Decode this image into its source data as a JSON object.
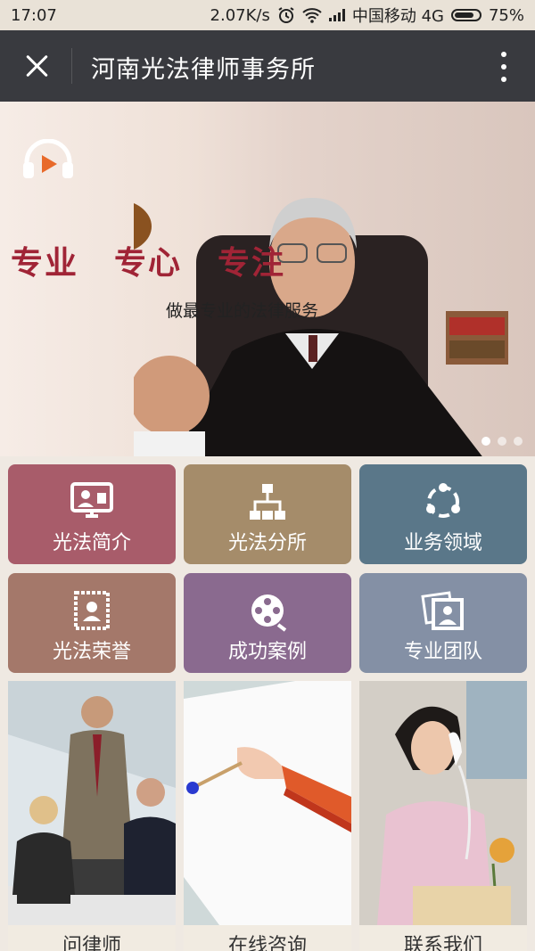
{
  "status": {
    "time": "17:07",
    "speed": "2.07K/s",
    "carrier": "中国移动 4G",
    "battery": "75%"
  },
  "header": {
    "title": "河南光法律师事务所"
  },
  "banner": {
    "slogans": [
      "专业",
      "专心",
      "专注"
    ],
    "subtitle": "做最专业的法律服务",
    "slides": 3,
    "active_slide": 1,
    "slogan_color": "#a02436"
  },
  "tiles": [
    {
      "label": "光法简介",
      "icon": "presentation-icon",
      "color": "#a85c6a"
    },
    {
      "label": "光法分所",
      "icon": "org-chart-icon",
      "color": "#a58c6a"
    },
    {
      "label": "业务领域",
      "icon": "circle-network-icon",
      "color": "#5a7789"
    },
    {
      "label": "光法荣誉",
      "icon": "certificate-icon",
      "color": "#a4786a"
    },
    {
      "label": "成功案例",
      "icon": "film-reel-icon",
      "color": "#8a6a8f"
    },
    {
      "label": "专业团队",
      "icon": "photo-stack-icon",
      "color": "#8490a5"
    }
  ],
  "cards": [
    {
      "label": "问律师"
    },
    {
      "label": "在线咨询"
    },
    {
      "label": "联系我们"
    }
  ]
}
